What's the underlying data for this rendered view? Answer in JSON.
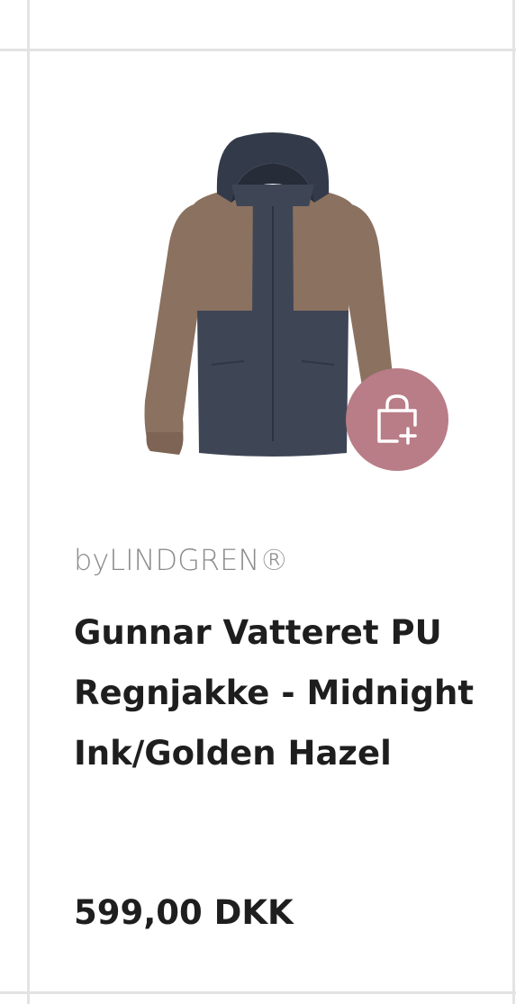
{
  "product": {
    "brand": "byLINDGREN®",
    "name": "Gunnar Vatteret PU Regnjakke - Midnight Ink/Golden Hazel",
    "price": "599,00 DKK",
    "image_icon": "jacket-image",
    "add_to_bag_icon": "shopping-bag-plus-icon"
  },
  "colors": {
    "accent": "#b97d87",
    "jacket_navy": "#3e4656",
    "jacket_brown": "#8b7160",
    "text": "#1e1e1e",
    "brand_text": "#8c8c8c"
  }
}
